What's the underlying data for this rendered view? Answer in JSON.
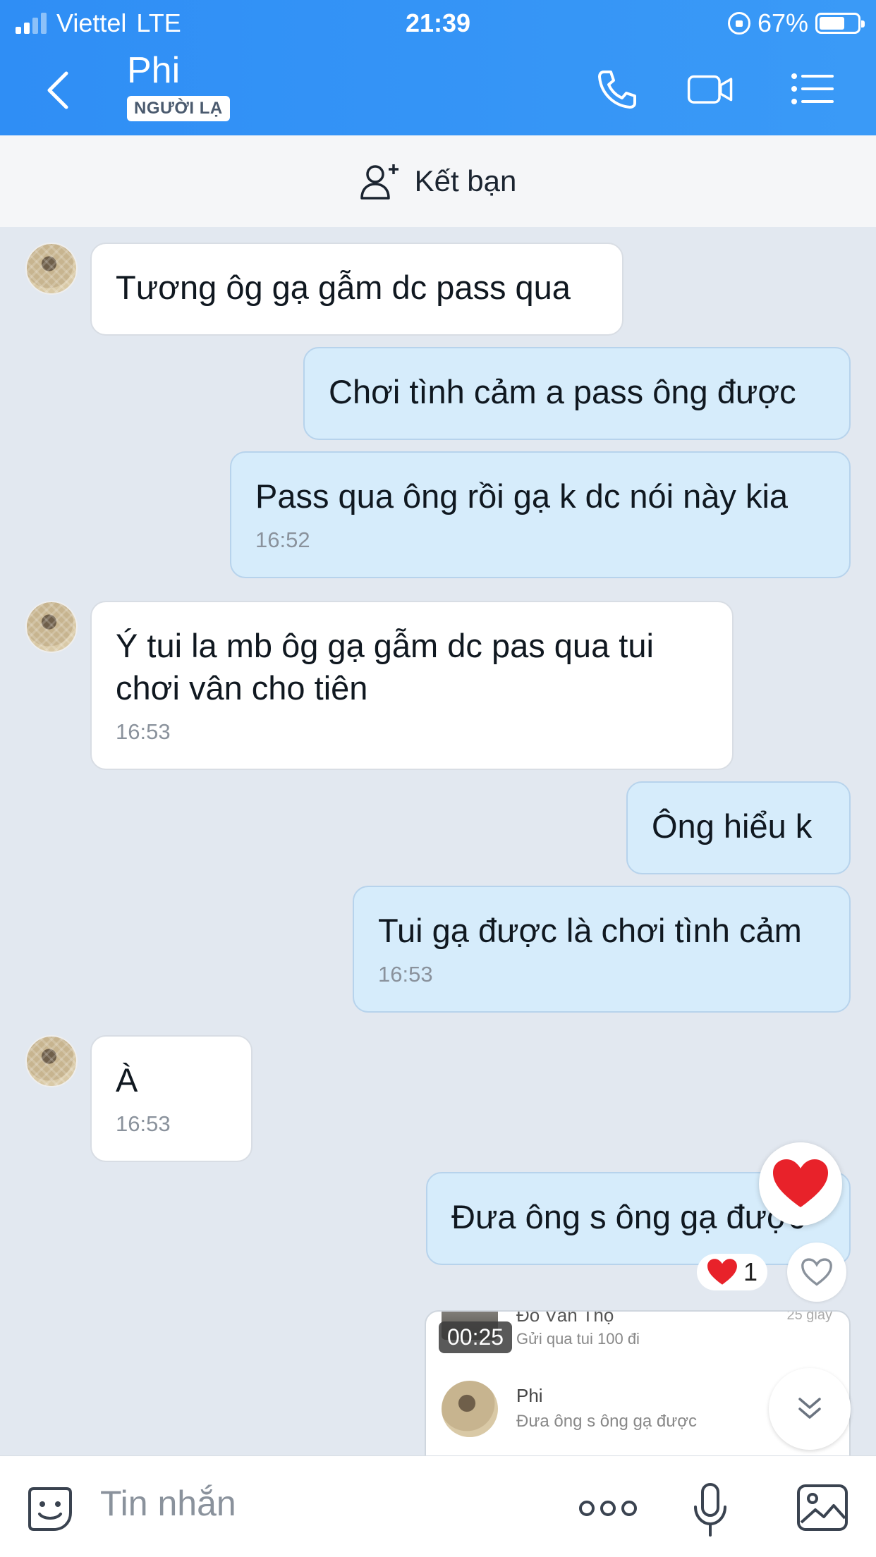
{
  "status": {
    "carrier": "Viettel",
    "network": "LTE",
    "time": "21:39",
    "battery": "67%",
    "battery_level": 0.67
  },
  "header": {
    "name": "Phi",
    "badge": "NGƯỜI LẠ"
  },
  "friend_bar": {
    "label": "Kết bạn"
  },
  "messages": [
    {
      "side": "in",
      "text": "Tương ôg gạ gẫm dc pass qua",
      "time": ""
    },
    {
      "side": "out",
      "text": "Chơi tình cảm a pass ông được",
      "time": ""
    },
    {
      "side": "out",
      "text": "Pass qua ông rồi gạ k dc nói này kia",
      "time": "16:52"
    },
    {
      "side": "in",
      "text": "Ý tui la mb ôg gạ gẫm dc pas qua tui chơi vân cho tiên",
      "time": "16:53"
    },
    {
      "side": "out",
      "text": "Ông hiểu k",
      "time": ""
    },
    {
      "side": "out",
      "text": "Tui gạ được là chơi tình cảm",
      "time": "16:53"
    },
    {
      "side": "in",
      "text": "À",
      "time": "16:53"
    },
    {
      "side": "out",
      "text": "Đưa ông s ông gạ được",
      "time": ""
    }
  ],
  "reaction": {
    "count": "1"
  },
  "preview": {
    "top_name": "Đỗ Văn Thọ",
    "top_text": "Gửi qua tui 100 đi",
    "top_ago": "25 giây",
    "timer": "00:25",
    "name": "Phi",
    "text": "Đưa ông s ông gạ được"
  },
  "input": {
    "placeholder": "Tin nhắn"
  },
  "colors": {
    "header": "#2f8ef5",
    "out_bubble": "#d6ecfb",
    "in_bubble": "#ffffff",
    "background": "#e2e8f0"
  }
}
